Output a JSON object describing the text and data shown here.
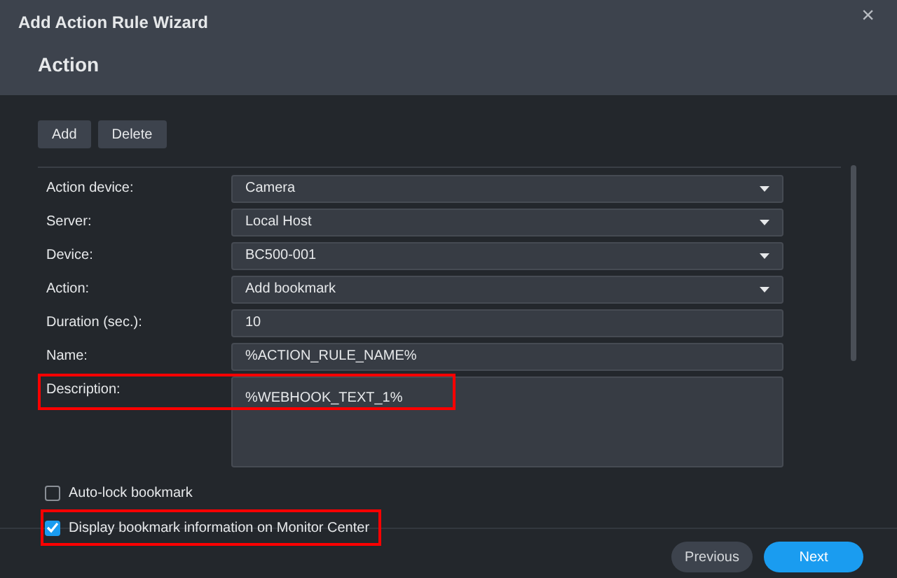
{
  "window": {
    "title": "Add Action Rule Wizard",
    "close": "×"
  },
  "step": {
    "title": "Action"
  },
  "toolbar": [
    "Add",
    "Delete"
  ],
  "fields": [
    {
      "label": "Action device:",
      "kind": "select",
      "value": "Camera",
      "highlighted": false
    },
    {
      "label": "Server:",
      "kind": "select",
      "value": "Local Host",
      "highlighted": false
    },
    {
      "label": "Device:",
      "kind": "select",
      "value": "BC500-001",
      "highlighted": false
    },
    {
      "label": "Action:",
      "kind": "select",
      "value": "Add bookmark",
      "highlighted": false
    },
    {
      "label": "Duration (sec.):",
      "kind": "text",
      "value": "10",
      "highlighted": false
    },
    {
      "label": "Name:",
      "kind": "text",
      "value": "%ACTION_RULE_NAME%",
      "highlighted": false
    },
    {
      "label": "Description:",
      "kind": "textarea",
      "value": "%WEBHOOK_TEXT_1%",
      "highlighted": true
    }
  ],
  "checkboxes": [
    {
      "label": "Auto-lock bookmark",
      "checked": false,
      "highlighted": false
    },
    {
      "label": "Display bookmark information on Monitor Center",
      "checked": true,
      "highlighted": true
    }
  ],
  "footer": {
    "previous": "Previous",
    "next": "Next"
  }
}
